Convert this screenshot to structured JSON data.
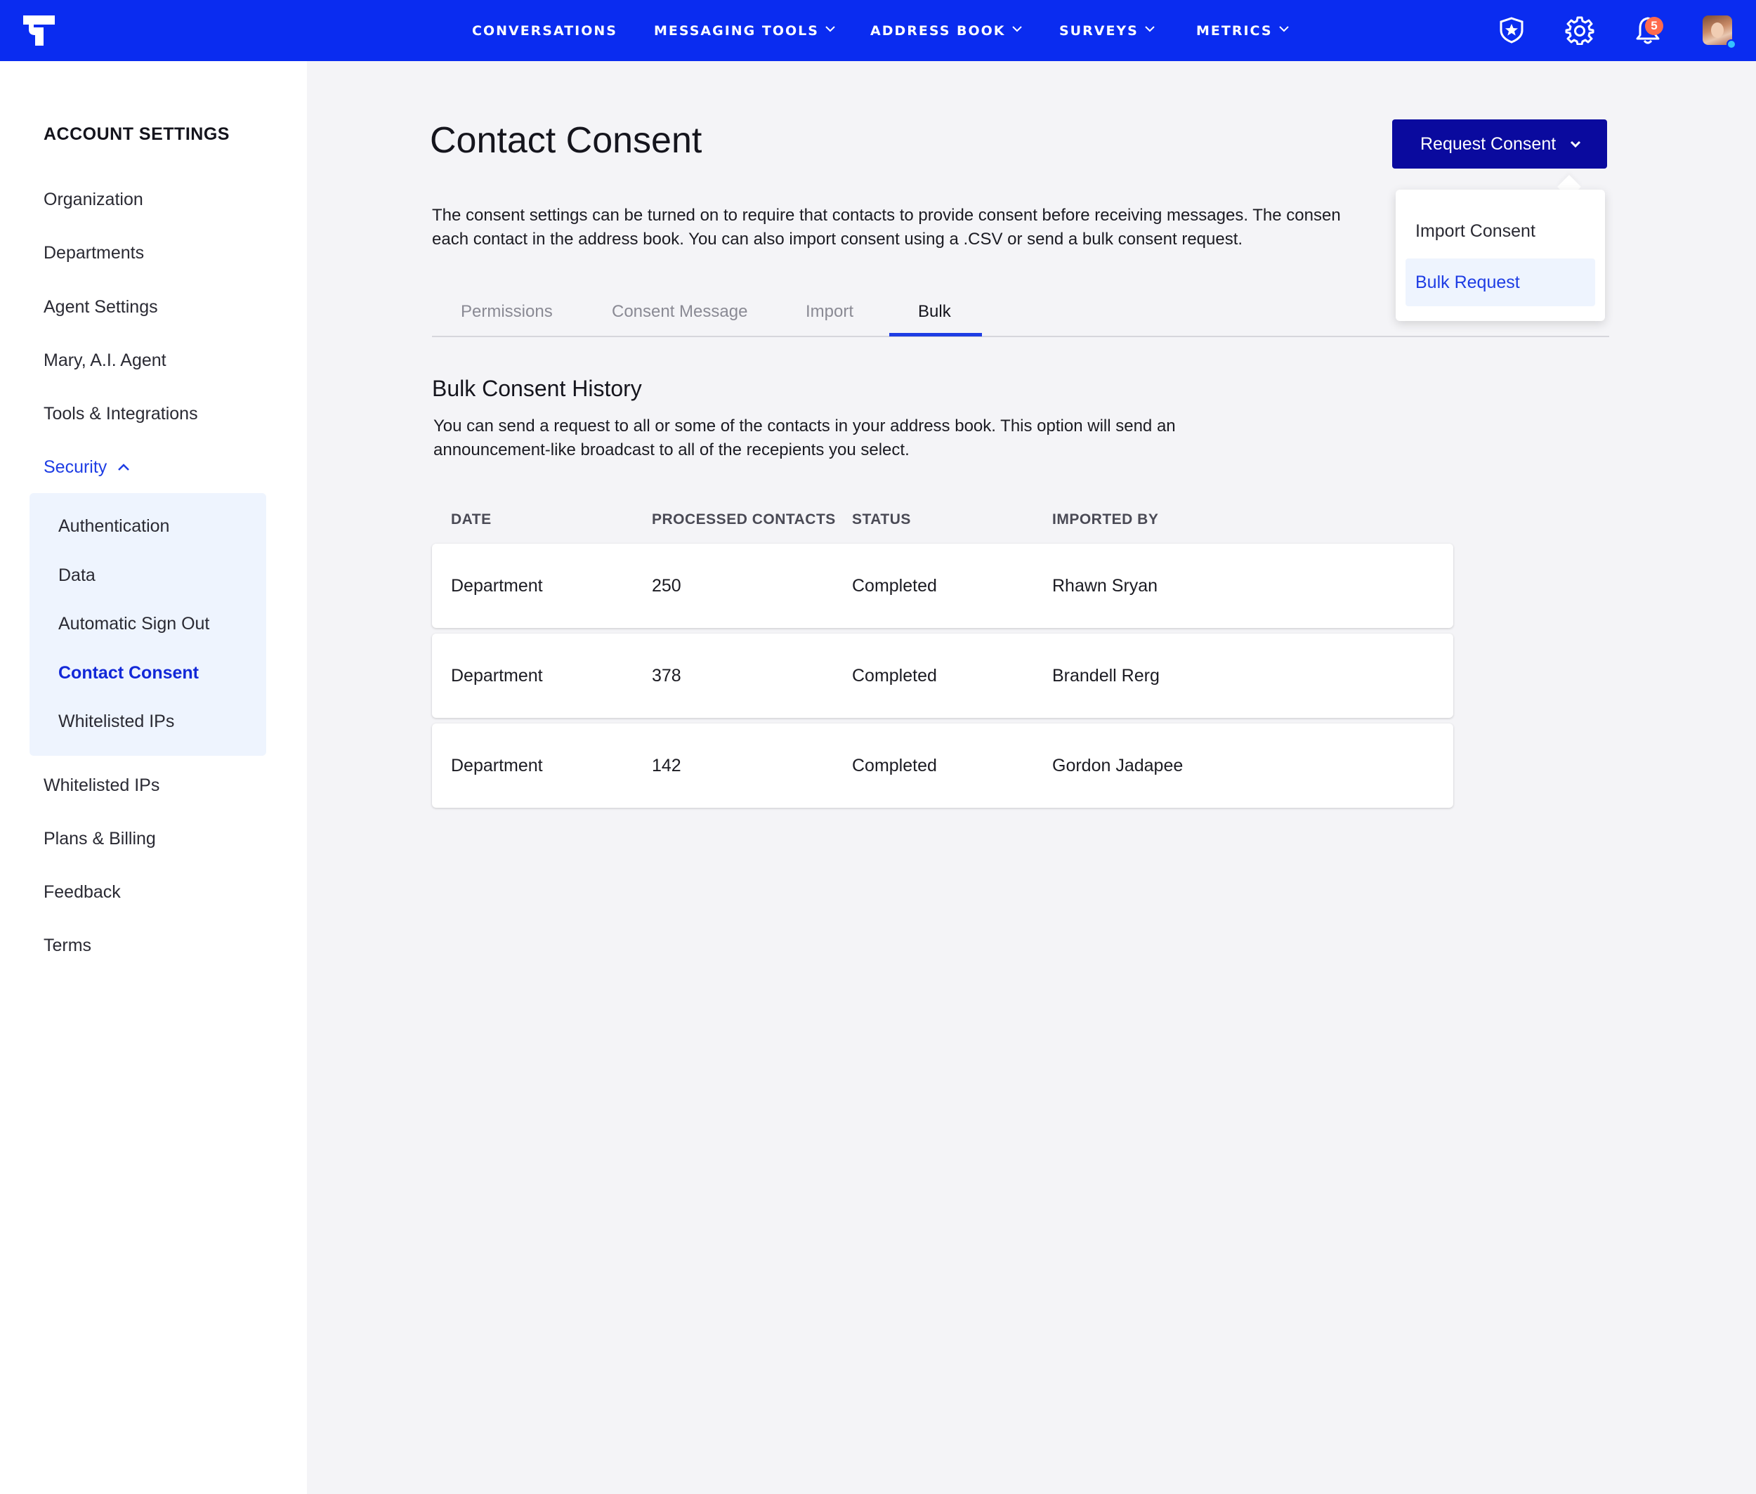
{
  "nav": {
    "items": [
      {
        "label": "CONVERSATIONS"
      },
      {
        "label": "MESSAGING TOOLS"
      },
      {
        "label": "ADDRESS BOOK"
      },
      {
        "label": "SURVEYS"
      },
      {
        "label": "METRICS"
      }
    ],
    "notification_count": "5",
    "icons": [
      "shield-star-icon",
      "gear-icon",
      "bell-icon",
      "user-avatar"
    ]
  },
  "sidebar": {
    "title": "ACCOUNT SETTINGS",
    "items": [
      {
        "label": "Organization"
      },
      {
        "label": "Departments"
      },
      {
        "label": "Agent Settings"
      },
      {
        "label": "Mary, A.I. Agent"
      },
      {
        "label": "Tools & Integrations"
      },
      {
        "label": "Security"
      }
    ],
    "security_sub": [
      {
        "label": "Authentication"
      },
      {
        "label": "Data"
      },
      {
        "label": "Automatic Sign Out"
      },
      {
        "label": "Contact Consent"
      },
      {
        "label": "Whitelisted IPs"
      }
    ],
    "items_after": [
      {
        "label": "Whitelisted IPs"
      },
      {
        "label": "Plans & Billing"
      },
      {
        "label": "Feedback"
      },
      {
        "label": "Terms"
      }
    ]
  },
  "main": {
    "title": "Contact Consent",
    "request_button": "Request Consent",
    "description_line1": "The consent settings can be turned on to require that contacts to provide consent before receiving messages. The consen",
    "description_line2": "each contact in the address book. You can also import consent using a .CSV or send a bulk consent request.",
    "tabs": [
      {
        "label": "Permissions"
      },
      {
        "label": "Consent Message"
      },
      {
        "label": "Import"
      },
      {
        "label": "Bulk"
      }
    ],
    "dropdown": [
      {
        "label": "Import Consent"
      },
      {
        "label": "Bulk Request"
      }
    ],
    "section_title": "Bulk Consent History",
    "section_desc_line1": "You can send a request to all or some of the contacts in your address book. This option will send an",
    "section_desc_line2": "announcement-like broadcast to all of the recepients you select.",
    "table": {
      "headers": [
        "DATE",
        "PROCESSED CONTACTS",
        "STATUS",
        "IMPORTED BY"
      ],
      "rows": [
        [
          "Department",
          "250",
          "Completed",
          "Rhawn Sryan"
        ],
        [
          "Department",
          "378",
          "Completed",
          "Brandell Rerg"
        ],
        [
          "Department",
          "142",
          "Completed",
          "Gordon Jadapee"
        ]
      ]
    }
  },
  "colors": {
    "topbar": "#0a2cf0",
    "primary_button": "#0a0a9e",
    "accent": "#1e3de4",
    "badge": "#ff6a4d"
  }
}
